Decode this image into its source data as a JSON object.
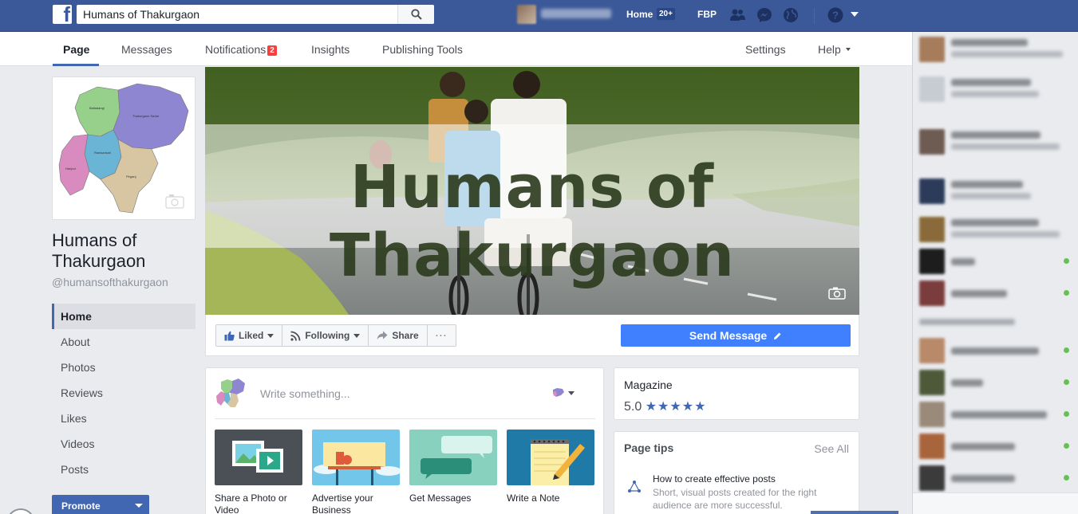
{
  "topbar": {
    "search_value": "Humans of Thakurgaon",
    "home_label": "Home",
    "home_badge": "20+",
    "fbp_label": "FBP"
  },
  "pagenav": {
    "tabs": [
      {
        "label": "Page"
      },
      {
        "label": "Messages"
      },
      {
        "label": "Notifications",
        "badge": "2"
      },
      {
        "label": "Insights"
      },
      {
        "label": "Publishing Tools"
      }
    ],
    "settings_label": "Settings",
    "help_label": "Help"
  },
  "page": {
    "name": "Humans of Thakurgaon",
    "handle": "@humansofthakurgaon",
    "cover_title": "Humans of Thakurgaon"
  },
  "map_labels": [
    "Baliadangi",
    "Thakurgaon Sadar",
    "Ranisankail",
    "Haripur",
    "Pirganj"
  ],
  "left_menu": [
    "Home",
    "About",
    "Photos",
    "Reviews",
    "Likes",
    "Videos",
    "Posts"
  ],
  "promote_label": "Promote",
  "actions": {
    "liked": "Liked",
    "following": "Following",
    "share": "Share",
    "more": "···",
    "send_message": "Send Message"
  },
  "composer": {
    "placeholder": "Write something...",
    "tiles": [
      {
        "label": "Share a Photo or Video"
      },
      {
        "label": "Advertise your Business"
      },
      {
        "label": "Get Messages"
      },
      {
        "label": "Write a Note"
      }
    ]
  },
  "magazine": {
    "category": "Magazine",
    "rating": "5.0",
    "stars": "★★★★★"
  },
  "page_tips": {
    "title": "Page tips",
    "see_all": "See All",
    "tip_title": "How to create effective posts",
    "tip_body": "Short, visual posts created for the right audience are more successful."
  },
  "colors": {
    "brand_blue": "#3b5998",
    "button_blue": "#4080ff",
    "notif_red": "#fa3e3e"
  }
}
